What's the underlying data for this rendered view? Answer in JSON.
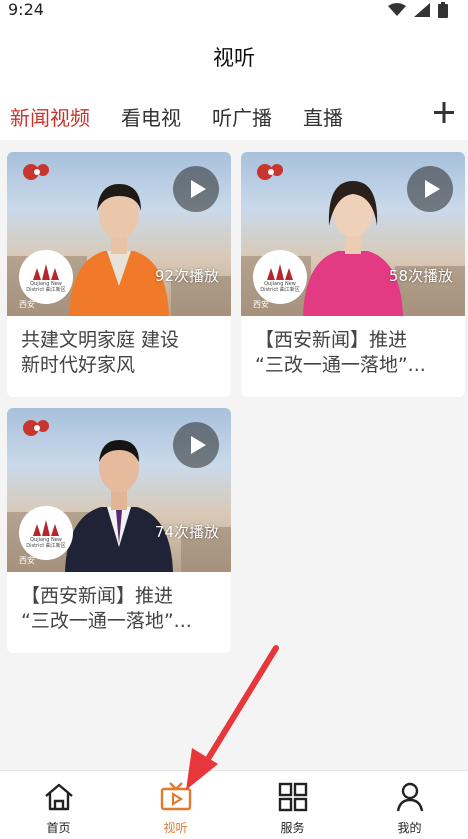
{
  "status_bar": {
    "time": "9:24"
  },
  "header": {
    "title": "视听"
  },
  "tabs": [
    {
      "label": "新闻视频",
      "active": true
    },
    {
      "label": "看电视",
      "active": false
    },
    {
      "label": "听广播",
      "active": false
    },
    {
      "label": "直播",
      "active": false
    }
  ],
  "videos": [
    {
      "plays": "92次播放",
      "caption_line1": "共建文明家庭  建设",
      "caption_line2": "新时代好家风"
    },
    {
      "plays": "58次播放",
      "caption_line1": "【西安新闻】推进",
      "caption_line2": "“三改一通一落地”..."
    },
    {
      "plays": "74次播放",
      "caption_line1": "【西安新闻】推进",
      "caption_line2": "“三改一通一落地”..."
    }
  ],
  "logo_text": "Qujiang New District 曲江新区",
  "corner_label": "西安",
  "bottom_nav": [
    {
      "label": "首页",
      "icon": "home-icon",
      "active": false
    },
    {
      "label": "视听",
      "icon": "tv-play-icon",
      "active": true
    },
    {
      "label": "服务",
      "icon": "grid-icon",
      "active": false
    },
    {
      "label": "我的",
      "icon": "user-icon",
      "active": false
    }
  ],
  "colors": {
    "accent_red": "#c8352e",
    "active_orange": "#e07a2c",
    "annotation_red": "#e8373b"
  }
}
